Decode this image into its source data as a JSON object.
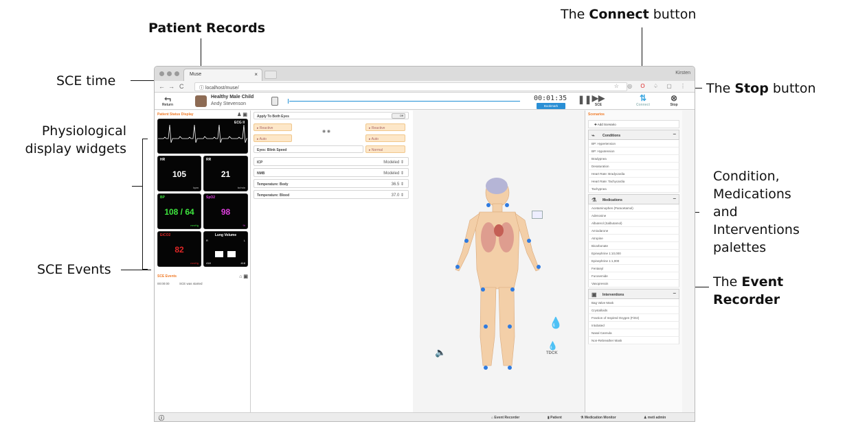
{
  "annotations": {
    "patient_records": "Patient Records",
    "connect_pre": "The ",
    "connect_bold": "Connect",
    "connect_post": " button",
    "sce_time": "SCE time",
    "stop_pre": "The ",
    "stop_bold": "Stop",
    "stop_post": " button",
    "physio_line1": "Physiological",
    "physio_line2": "display widgets",
    "palettes_lines": [
      "Condition,",
      "Medications",
      "and",
      "Interventions",
      "palettes"
    ],
    "sce_events": "SCE Events",
    "recorder_pre": "The ",
    "recorder_bold1": "Event",
    "recorder_bold2": "Recorder"
  },
  "browser": {
    "tab_title": "Muse",
    "user": "Kirsten",
    "url": "localhost/muse/"
  },
  "toolbar": {
    "return_label": "Return",
    "patient_name": "Healthy Male Child",
    "operator_name": "Andy Stevenson",
    "time": "00:01:35",
    "bookmark_label": "Bookmark",
    "sce_label": "SCE",
    "connect_label": "Connect",
    "stop_label": "Stop"
  },
  "left": {
    "header": "Patient Status Display",
    "ecg_label": "ECG II",
    "widgets": [
      {
        "label": "HR",
        "value": "105",
        "unit": "bpm",
        "color": "#ffffff"
      },
      {
        "label": "RR",
        "value": "21",
        "unit": "br/min",
        "color": "#ffffff"
      },
      {
        "label": "BP",
        "value": "108 / 64",
        "unit": "mmHg",
        "color": "#3ee63e"
      },
      {
        "label": "SpO2",
        "value": "98",
        "unit": "%",
        "color": "#e040e0"
      },
      {
        "label": "EtCO2",
        "value": "82",
        "unit": "mmHg",
        "color": "#e02626"
      },
      {
        "label": "Lung Volume",
        "value": "",
        "unit": "",
        "color": "#ffffff"
      }
    ],
    "lung_r": "R",
    "lung_l": "L",
    "lung_vol_l": "418",
    "lung_vol_r": "418",
    "events_header": "SCE Events",
    "events": [
      {
        "time": "00:00:00",
        "text": "SCE was started"
      }
    ]
  },
  "mid": {
    "apply_label": "Apply To Both Eyes",
    "toggle_label": "Off",
    "reactive_left": "Reactive",
    "reactive_right": "Reactive",
    "auto_left": "Auto",
    "auto_right": "Auto",
    "blink_label": "Eyes: Blink Speed",
    "blink_value": "Normal",
    "rows": [
      {
        "label": "ICP",
        "value": "Modeled"
      },
      {
        "label": "NMB",
        "value": "Modeled"
      },
      {
        "label": "Temperature: Body",
        "value": "36.5"
      },
      {
        "label": "Temperature: Blood",
        "value": "37.0"
      }
    ]
  },
  "stage": {
    "tdck_label": "TDCK"
  },
  "right": {
    "header": "Scenarios",
    "add_label": "Add Scenario",
    "conditions_title": "Conditions",
    "conditions": [
      "BP: Hypertension",
      "BP: Hypotension",
      "Bradypnea",
      "Desaturation",
      "Heart Rate: Bradycardia",
      "Heart Rate: Tachycardia",
      "Tachypnea"
    ],
    "medications_title": "Medications",
    "medications": [
      "Acetaminophen (Paracetamol)",
      "Adenosine",
      "Albuterol (Salbutamol)",
      "Amiodarone",
      "Atropine",
      "Bicarbonate",
      "Epinephrine 1:10,000",
      "Epinephrine 1:1,000",
      "Fentanyl",
      "Furosemide",
      "Vasopressin"
    ],
    "interventions_title": "Interventions",
    "interventions": [
      "Bag Valve Mask",
      "Crystalloids",
      "Fraction of Inspired Oxygen (FiO2)",
      "Intubated",
      "Nasal Cannula",
      "Non-Rebreather Mask"
    ]
  },
  "statusbar": {
    "event_recorder": "Event Recorder",
    "patient": "Patient",
    "medication_monitor": "Medication Monitor",
    "user": "meti admin"
  }
}
